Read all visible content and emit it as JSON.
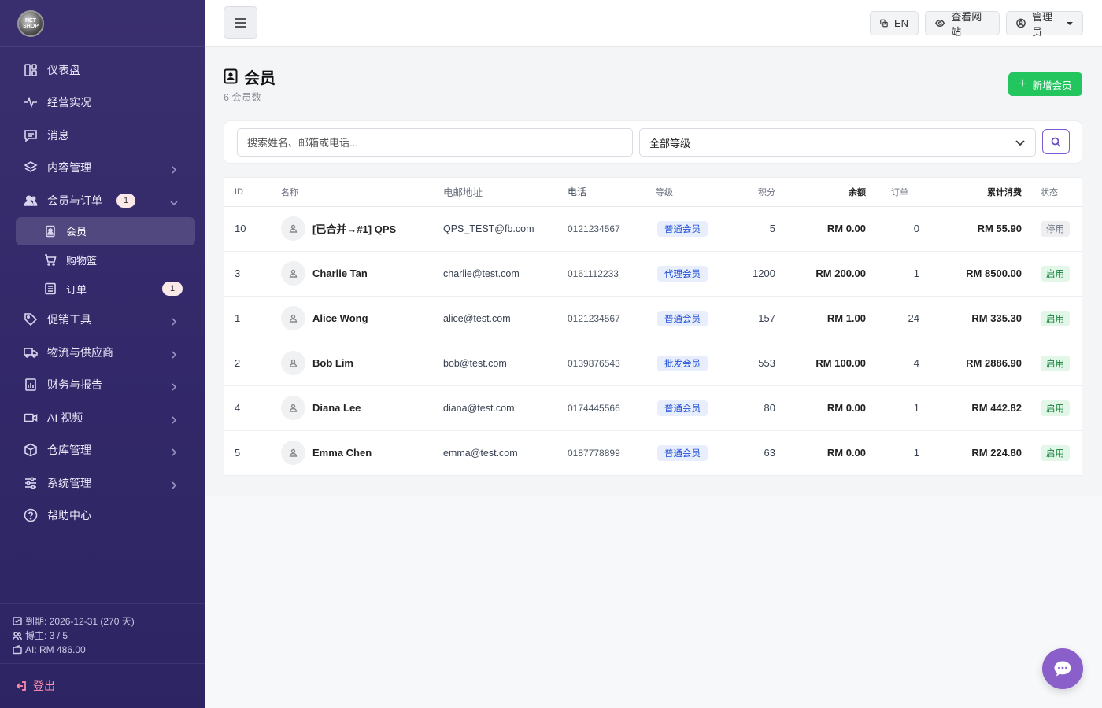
{
  "logo_text": "NET SHOP",
  "sidebar": {
    "items": [
      {
        "label": "仪表盘",
        "icon": "dashboard-icon"
      },
      {
        "label": "经营实况",
        "icon": "activity-icon"
      },
      {
        "label": "消息",
        "icon": "message-icon"
      },
      {
        "label": "内容管理",
        "icon": "layers-icon"
      },
      {
        "label": "会员与订单",
        "icon": "users-icon",
        "badge": "1"
      },
      {
        "label": "促销工具",
        "icon": "tag-icon"
      },
      {
        "label": "物流与供应商",
        "icon": "truck-icon"
      },
      {
        "label": "财务与报告",
        "icon": "report-icon"
      },
      {
        "label": "AI 视频",
        "icon": "video-icon"
      },
      {
        "label": "仓库管理",
        "icon": "box-icon"
      },
      {
        "label": "系统管理",
        "icon": "sliders-icon"
      },
      {
        "label": "帮助中心",
        "icon": "help-icon"
      }
    ],
    "sub_items": [
      {
        "label": "会员",
        "icon": "member-card-icon"
      },
      {
        "label": "购物篮",
        "icon": "cart-icon"
      },
      {
        "label": "订单",
        "icon": "order-icon",
        "badge": "1"
      }
    ],
    "footer": {
      "expiry": "到期: 2026-12-31 (270 天)",
      "hosts": "博主: 3 / 5",
      "ai": "AI: RM 486.00"
    },
    "logout": "登出"
  },
  "topbar": {
    "lang": "EN",
    "view_site": "查看网站",
    "admin": "管理员"
  },
  "page": {
    "title": "会员",
    "subtitle": "6 会员数",
    "add_button": "新增会员"
  },
  "filters": {
    "search_placeholder": "搜索姓名、邮箱或电话...",
    "level_selected": "全部等级"
  },
  "table": {
    "headers": {
      "id": "ID",
      "name": "名称",
      "email": "电邮地址",
      "phone": "电话",
      "level": "等级",
      "points": "积分",
      "balance": "余额",
      "orders": "订单",
      "spent": "累计消费",
      "status": "状态"
    },
    "rows": [
      {
        "id": "10",
        "name": "[已合并→#1] QPS",
        "email": "QPS_TEST@fb.com",
        "phone": "0121234567",
        "level": "普通会员",
        "points": "5",
        "balance": "RM 0.00",
        "orders": "0",
        "spent": "RM 55.90",
        "status": "停用",
        "active": false
      },
      {
        "id": "3",
        "name": "Charlie Tan",
        "email": "charlie@test.com",
        "phone": "0161112233",
        "level": "代理会员",
        "points": "1200",
        "balance": "RM 200.00",
        "orders": "1",
        "spent": "RM 8500.00",
        "status": "启用",
        "active": true
      },
      {
        "id": "1",
        "name": "Alice Wong",
        "email": "alice@test.com",
        "phone": "0121234567",
        "level": "普通会员",
        "points": "157",
        "balance": "RM 1.00",
        "orders": "24",
        "spent": "RM 335.30",
        "status": "启用",
        "active": true
      },
      {
        "id": "2",
        "name": "Bob Lim",
        "email": "bob@test.com",
        "phone": "0139876543",
        "level": "批发会员",
        "points": "553",
        "balance": "RM 100.00",
        "orders": "4",
        "spent": "RM 2886.90",
        "status": "启用",
        "active": true
      },
      {
        "id": "4",
        "name": "Diana Lee",
        "email": "diana@test.com",
        "phone": "0174445566",
        "level": "普通会员",
        "points": "80",
        "balance": "RM 0.00",
        "orders": "1",
        "spent": "RM 442.82",
        "status": "启用",
        "active": true
      },
      {
        "id": "5",
        "name": "Emma Chen",
        "email": "emma@test.com",
        "phone": "0187778899",
        "level": "普通会员",
        "points": "63",
        "balance": "RM 0.00",
        "orders": "1",
        "spent": "RM 224.80",
        "status": "启用",
        "active": true
      }
    ]
  },
  "colors": {
    "sidebar": "#33296a",
    "accent_green": "#22c55e",
    "accent_purple": "#8b5fc9"
  }
}
